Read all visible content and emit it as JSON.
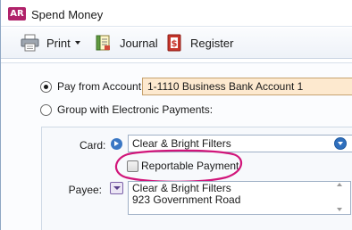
{
  "window": {
    "app_logo": "AR",
    "title": "Spend Money"
  },
  "toolbar": {
    "print_label": "Print",
    "journal_label": "Journal",
    "register_label": "Register",
    "icons": {
      "print": "printer-icon",
      "journal": "journal-icon",
      "register": "register-icon"
    }
  },
  "payment_source": {
    "pay_from_label": "Pay from Account:",
    "pay_from_selected": true,
    "account_value": "1-1110 Business Bank Account 1",
    "group_label": "Group with Electronic Payments:",
    "group_selected": false
  },
  "card": {
    "label": "Card:",
    "value": "Clear & Bright Filters",
    "reportable_label": "Reportable Payment",
    "reportable_checked": false
  },
  "payee": {
    "label": "Payee:",
    "address_lines": [
      "Clear & Bright Filters",
      "923 Government Road"
    ]
  },
  "colors": {
    "logo": "#b0226a",
    "highlight": "#d1157a",
    "account_field_bg": "#fde9cf",
    "accent_blue": "#2f6fbd"
  }
}
